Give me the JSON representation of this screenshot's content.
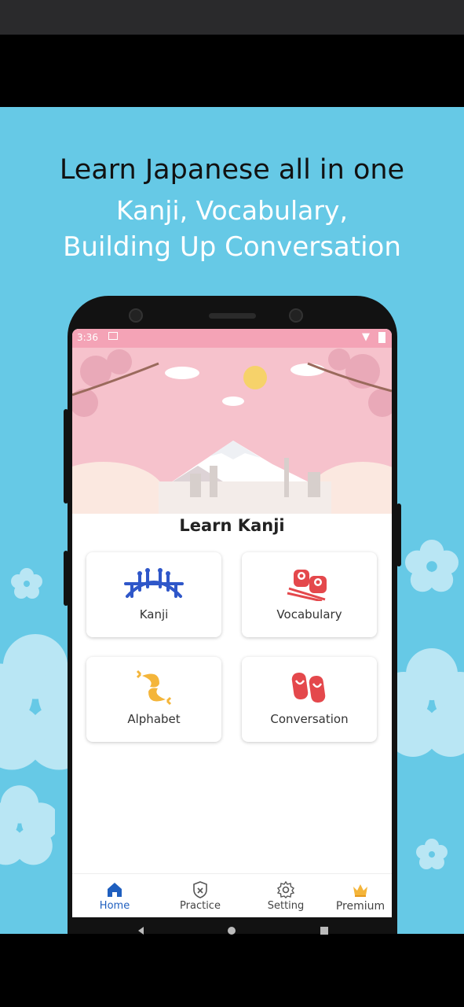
{
  "promo": {
    "headline": "Learn Japanese all in one",
    "subline1": "Kanji, Vocabulary,",
    "subline2": "Building Up Conversation"
  },
  "status_bar": {
    "time": "3:36"
  },
  "app": {
    "title": "Learn Kanji",
    "cards": [
      {
        "label": "Kanji",
        "icon": "bridge-icon"
      },
      {
        "label": "Vocabulary",
        "icon": "sushi-icon"
      },
      {
        "label": "Alphabet",
        "icon": "koi-fish-icon"
      },
      {
        "label": "Conversation",
        "icon": "geta-sandals-icon"
      }
    ]
  },
  "bottom_nav": {
    "items": [
      {
        "label": "Home",
        "icon": "home-icon",
        "active": true
      },
      {
        "label": "Practice",
        "icon": "shield-icon",
        "active": false
      },
      {
        "label": "Setting",
        "icon": "gear-icon",
        "active": false
      },
      {
        "label": "Premium",
        "icon": "crown-icon",
        "active": false
      }
    ]
  },
  "colors": {
    "background": "#66c9e6",
    "accent_blue": "#2f6fd6",
    "pink": "#f4a3b6",
    "card_red": "#e4484c",
    "gold": "#f4b53a"
  }
}
